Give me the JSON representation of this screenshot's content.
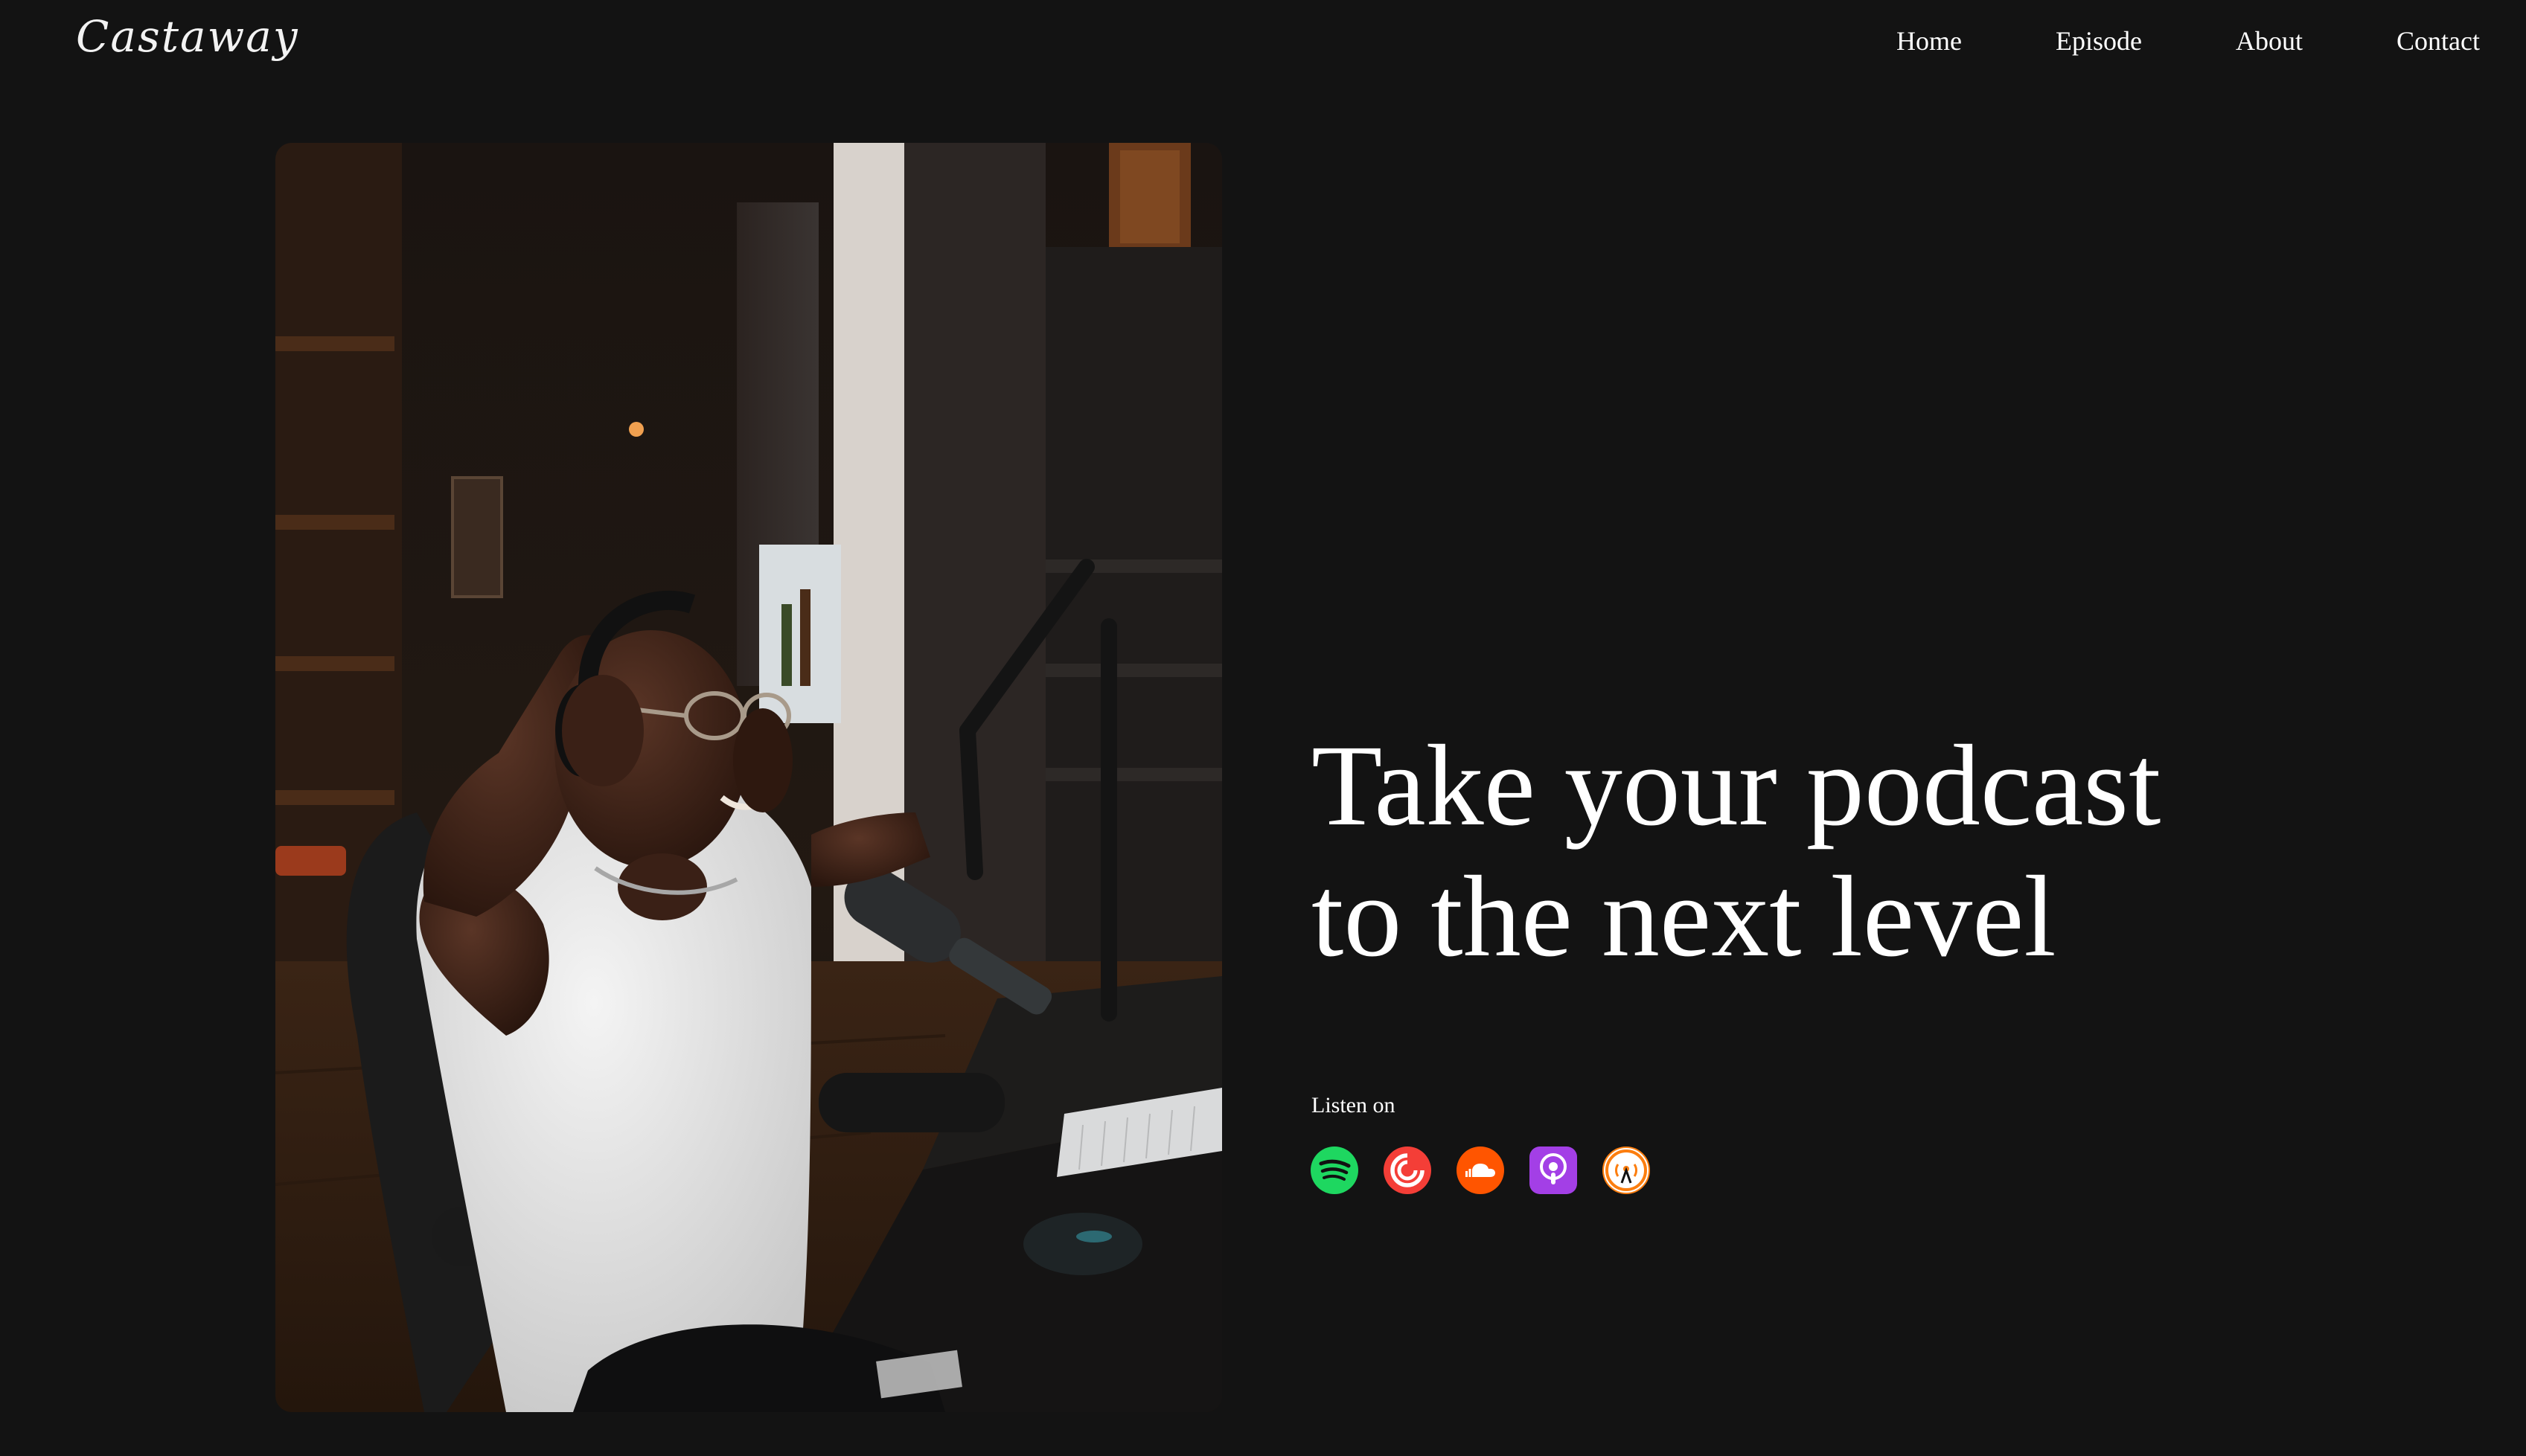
{
  "brand": {
    "name": "Castaway"
  },
  "nav": {
    "items": [
      {
        "label": "Home"
      },
      {
        "label": "Episode"
      },
      {
        "label": "About"
      },
      {
        "label": "Contact"
      }
    ]
  },
  "hero": {
    "headline_line1": "Take your podcast",
    "headline_line2": "to the next level",
    "listen_label": "Listen on",
    "platforms": [
      {
        "icon": "spotify-icon",
        "color": "#1ed760"
      },
      {
        "icon": "pocket-casts-icon",
        "color": "#f43e37"
      },
      {
        "icon": "soundcloud-icon",
        "color": "#ff5500"
      },
      {
        "icon": "apple-podcasts-icon",
        "color": "#a33fe6"
      },
      {
        "icon": "overcast-icon",
        "color": "#fc7e0f"
      }
    ]
  },
  "colors": {
    "background": "#131313",
    "text": "#ffffff"
  }
}
